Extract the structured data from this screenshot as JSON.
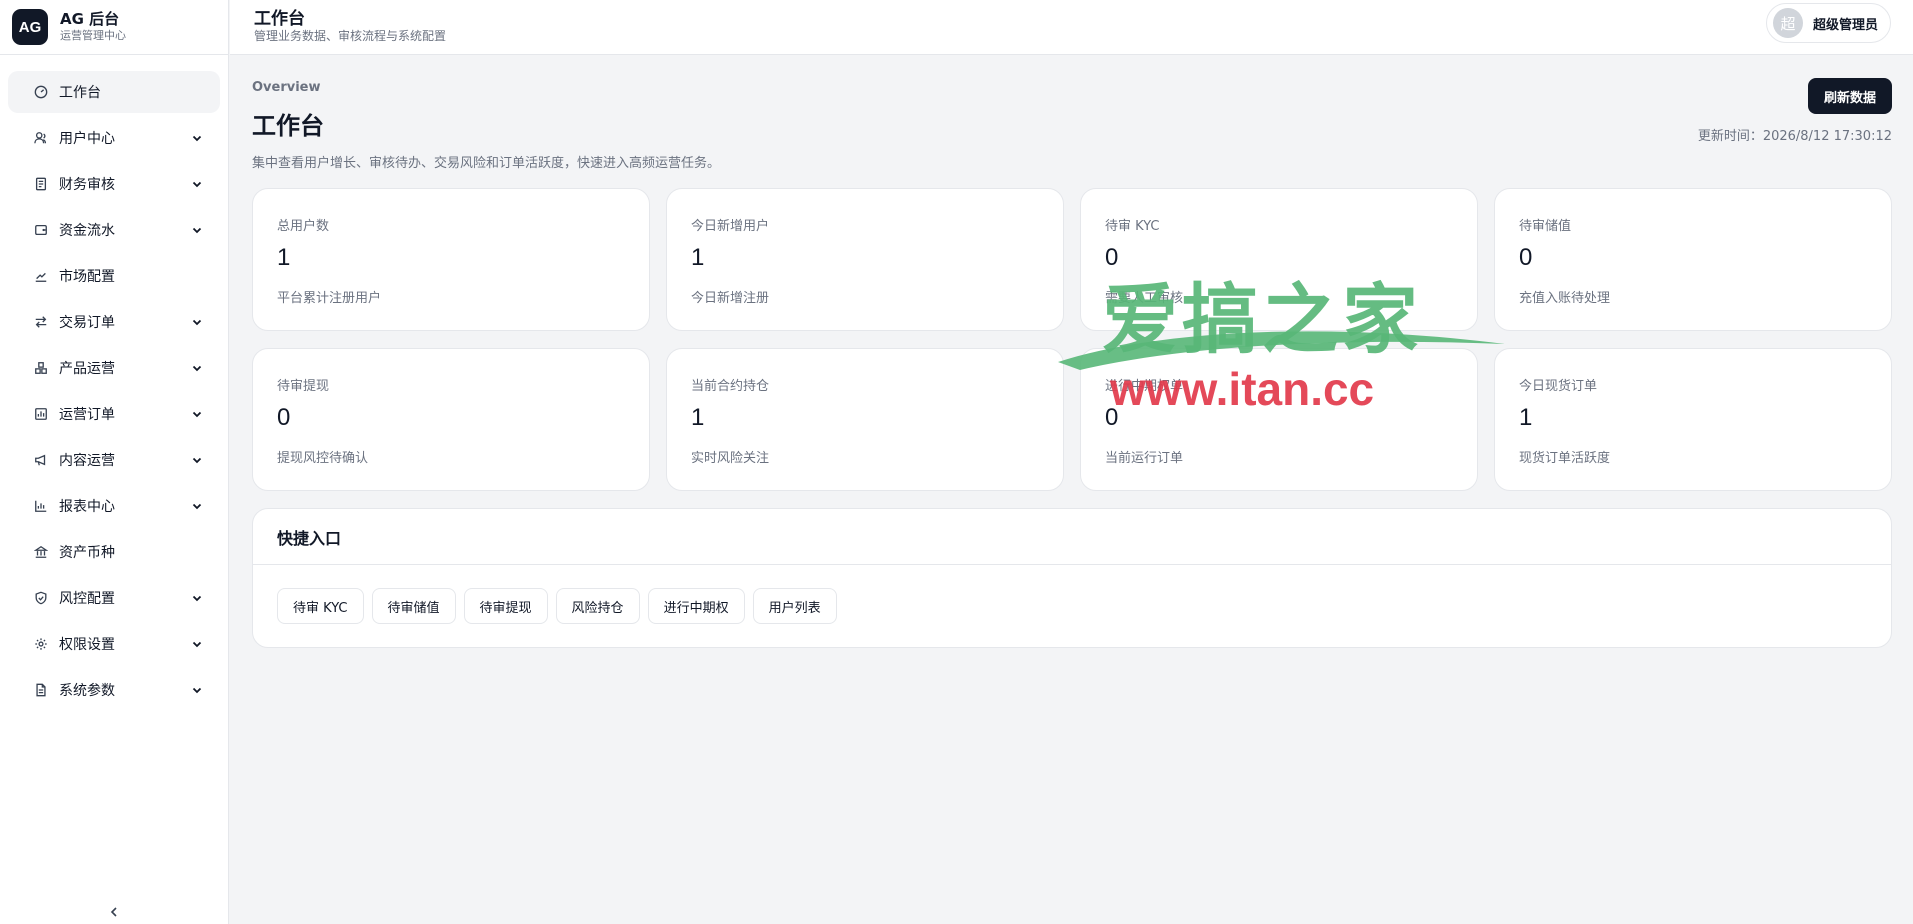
{
  "brand": {
    "logo_text": "AG",
    "title": "AG 后台",
    "subtitle": "运营管理中心"
  },
  "sidebar": {
    "items": [
      {
        "label": "工作台",
        "icon": "gauge-icon",
        "has_children": false,
        "active": true
      },
      {
        "label": "用户中心",
        "icon": "users-icon",
        "has_children": true
      },
      {
        "label": "财务审核",
        "icon": "receipt-icon",
        "has_children": true
      },
      {
        "label": "资金流水",
        "icon": "wallet-icon",
        "has_children": true
      },
      {
        "label": "市场配置",
        "icon": "trend-line-icon",
        "has_children": false
      },
      {
        "label": "交易订单",
        "icon": "swap-icon",
        "has_children": true
      },
      {
        "label": "产品运营",
        "icon": "boxes-icon",
        "has_children": true
      },
      {
        "label": "运营订单",
        "icon": "bar-chart-box-icon",
        "has_children": true
      },
      {
        "label": "内容运营",
        "icon": "megaphone-icon",
        "has_children": true
      },
      {
        "label": "报表中心",
        "icon": "bar-chart-icon",
        "has_children": true
      },
      {
        "label": "资产币种",
        "icon": "bank-icon",
        "has_children": false
      },
      {
        "label": "风控配置",
        "icon": "shield-icon",
        "has_children": true
      },
      {
        "label": "权限设置",
        "icon": "gear-icon",
        "has_children": true
      },
      {
        "label": "系统参数",
        "icon": "document-icon",
        "has_children": true
      }
    ],
    "collapse_icon": "chevron-left-icon"
  },
  "header": {
    "title": "工作台",
    "subtitle": "管理业务数据、审核流程与系统配置",
    "user": {
      "avatar_text": "超",
      "name": "超级管理员"
    }
  },
  "main": {
    "overview_label": "Overview",
    "title": "工作台",
    "description": "集中查看用户增长、审核待办、交易风险和订单活跃度，快速进入高频运营任务。",
    "refresh_label": "刷新数据",
    "updated_text": "更新时间：2026/8/12 17:30:12",
    "stats": [
      {
        "label": "总用户数",
        "value": "1",
        "note": "平台累计注册用户"
      },
      {
        "label": "今日新增用户",
        "value": "1",
        "note": "今日新增注册"
      },
      {
        "label": "待审 KYC",
        "value": "0",
        "note": "需要人工审核"
      },
      {
        "label": "待审储值",
        "value": "0",
        "note": "充值入账待处理"
      },
      {
        "label": "待审提现",
        "value": "0",
        "note": "提现风控待确认"
      },
      {
        "label": "当前合约持仓",
        "value": "1",
        "note": "实时风险关注"
      },
      {
        "label": "进行中期权单",
        "value": "0",
        "note": "当前运行订单"
      },
      {
        "label": "今日现货订单",
        "value": "1",
        "note": "现货订单活跃度"
      }
    ],
    "quick": {
      "title": "快捷入口",
      "buttons": [
        "待审 KYC",
        "待审储值",
        "待审提现",
        "风险持仓",
        "进行中期权",
        "用户列表"
      ]
    }
  },
  "watermark": {
    "cn": "爱搞之家",
    "en": "www.itan.cc"
  },
  "colors": {
    "primary": "#111827",
    "muted": "#6b7280",
    "border": "#e5e7eb",
    "bg": "#f3f4f6",
    "watermark_green": "#58b778",
    "watermark_red": "#e23a4b"
  }
}
